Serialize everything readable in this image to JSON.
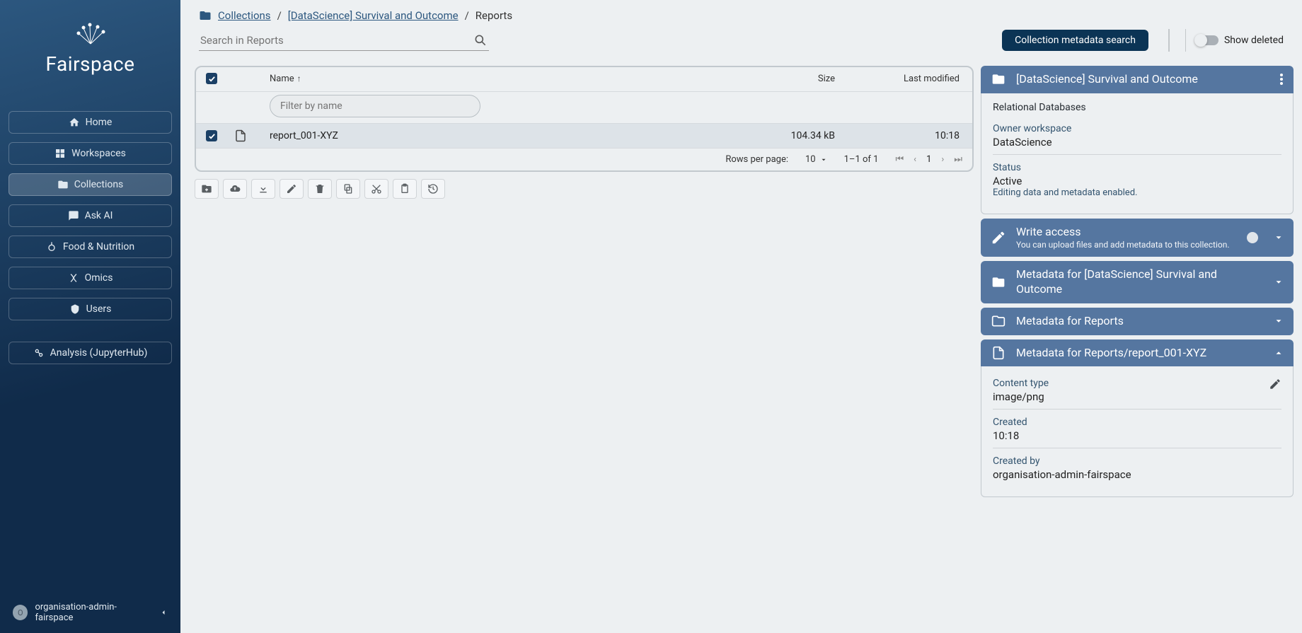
{
  "brand": "Fairspace",
  "sidebar": {
    "items": [
      {
        "label": "Home"
      },
      {
        "label": "Workspaces"
      },
      {
        "label": "Collections"
      },
      {
        "label": "Ask AI"
      },
      {
        "label": "Food & Nutrition"
      },
      {
        "label": "Omics"
      },
      {
        "label": "Users"
      }
    ],
    "analysis_label": "Analysis (JupyterHub)",
    "user": "organisation-admin-fairspace",
    "user_initial": "O"
  },
  "breadcrumb": {
    "root": "Collections",
    "path": "[DataScience] Survival and Outcome",
    "current": "Reports"
  },
  "search": {
    "placeholder": "Search in Reports",
    "meta_btn": "Collection metadata search",
    "show_deleted": "Show deleted"
  },
  "table": {
    "cols": {
      "name": "Name",
      "size": "Size",
      "modified": "Last modified"
    },
    "filter_placeholder": "Filter by name",
    "rows": [
      {
        "name": "report_001-XYZ",
        "size": "104.34 kB",
        "modified": "10:18"
      }
    ],
    "rows_per_page_label": "Rows per page:",
    "rows_per_page": "10",
    "range": "1–1 of 1",
    "page": "1"
  },
  "details": {
    "collection": {
      "title": "[DataScience] Survival and Outcome",
      "subtitle": "Relational Databases",
      "owner_label": "Owner workspace",
      "owner": "DataScience",
      "status_label": "Status",
      "status": "Active",
      "status_hint": "Editing data and metadata enabled."
    },
    "access": {
      "title": "Write access",
      "subtitle": "You can upload files and add metadata to this collection."
    },
    "meta_collection": {
      "title": "Metadata for [DataScience] Survival and Outcome"
    },
    "meta_folder": {
      "title": "Metadata for Reports"
    },
    "meta_file": {
      "title": "Metadata for Reports/report_001-XYZ",
      "content_type_label": "Content type",
      "content_type": "image/png",
      "created_label": "Created",
      "created": "10:18",
      "created_by_label": "Created by",
      "created_by": "organisation-admin-fairspace"
    }
  }
}
